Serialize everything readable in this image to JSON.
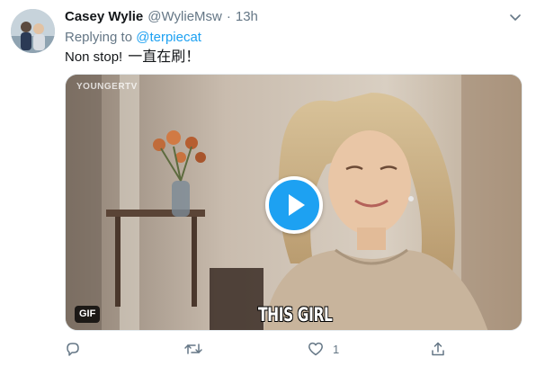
{
  "author": {
    "display_name": "Casey Wylie",
    "handle": "@WylieMsw",
    "time_separator": "·",
    "time": "13h",
    "avatar_icon": "avatar-photo"
  },
  "reply": {
    "prefix": "Replying to",
    "mention": "@terpiecat"
  },
  "tweet_text": {
    "latin": "Non stop!",
    "chinese": "一直在刷！"
  },
  "media": {
    "type": "gif",
    "watermark": "YOUNGERTV",
    "gif_badge": "GIF",
    "caption": "THIS GIRL",
    "play_icon": "play-icon"
  },
  "actions": {
    "reply_icon": "reply-icon",
    "retweet_icon": "retweet-icon",
    "like_icon": "heart-icon",
    "like_count": "1",
    "share_icon": "share-icon",
    "menu_icon": "chevron-down-icon"
  },
  "colors": {
    "accent": "#1da1f2",
    "secondary_text": "#657786",
    "primary_text": "#14171a"
  }
}
